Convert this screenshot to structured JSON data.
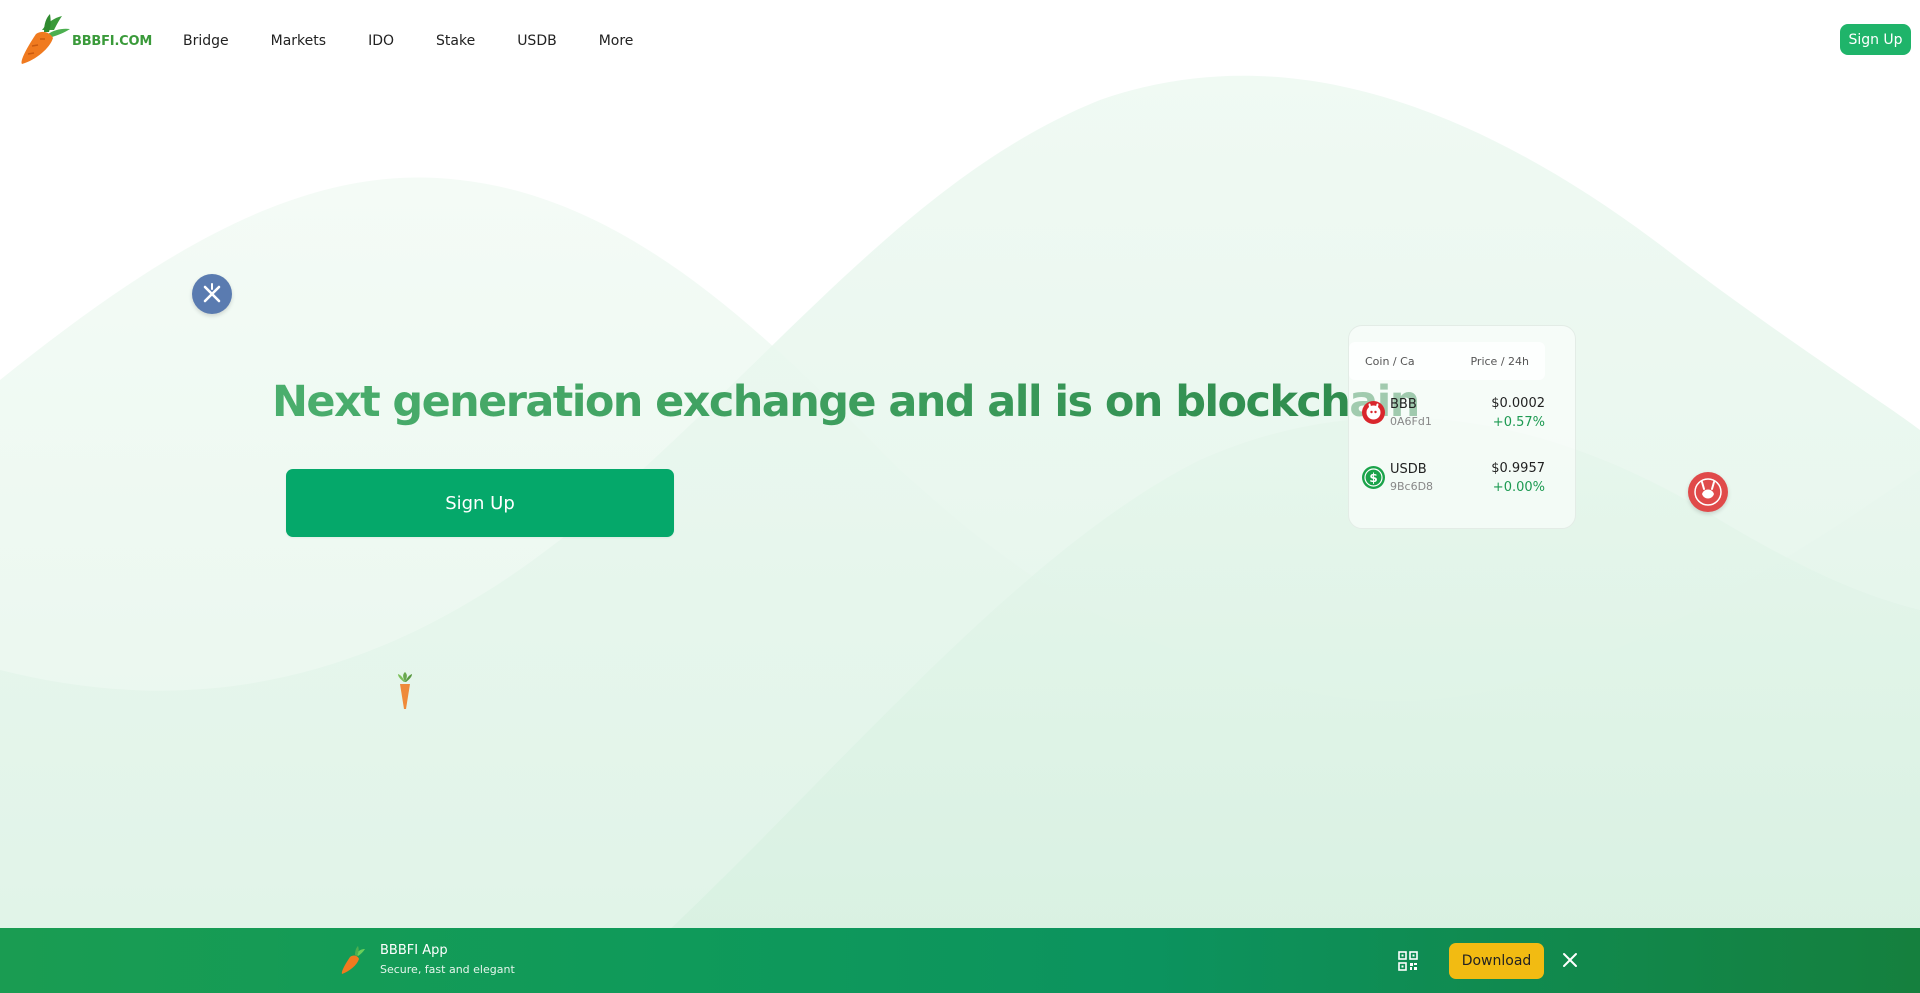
{
  "header": {
    "logo_text": "BBBFI.COM",
    "nav": [
      {
        "label": "Bridge"
      },
      {
        "label": "Markets"
      },
      {
        "label": "IDO"
      },
      {
        "label": "Stake"
      },
      {
        "label": "USDB"
      },
      {
        "label": "More"
      }
    ],
    "signup_label": "Sign Up"
  },
  "hero": {
    "title": "Next generation exchange and all is on blockchain",
    "signup_label": "Sign Up"
  },
  "coin_table": {
    "col_coin": "Coin / Ca",
    "col_price": "Price / 24h",
    "rows": [
      {
        "name": "BBB",
        "ca": "0A6Fd1",
        "price": "$0.0002",
        "change": "+0.57%",
        "icon": "bbb-coin-icon"
      },
      {
        "name": "USDB",
        "ca": "9Bc6D8",
        "price": "$0.9957",
        "change": "+0.00%",
        "icon": "usdb-coin-icon"
      }
    ]
  },
  "app_banner": {
    "title": "BBBFI App",
    "subtitle": "Secure, fast and elegant",
    "download_label": "Download"
  },
  "colors": {
    "brand_green": "#05a86a",
    "header_button": "#1fb46a",
    "download_yellow": "#f2bb12",
    "title_green": "#3fa467"
  }
}
